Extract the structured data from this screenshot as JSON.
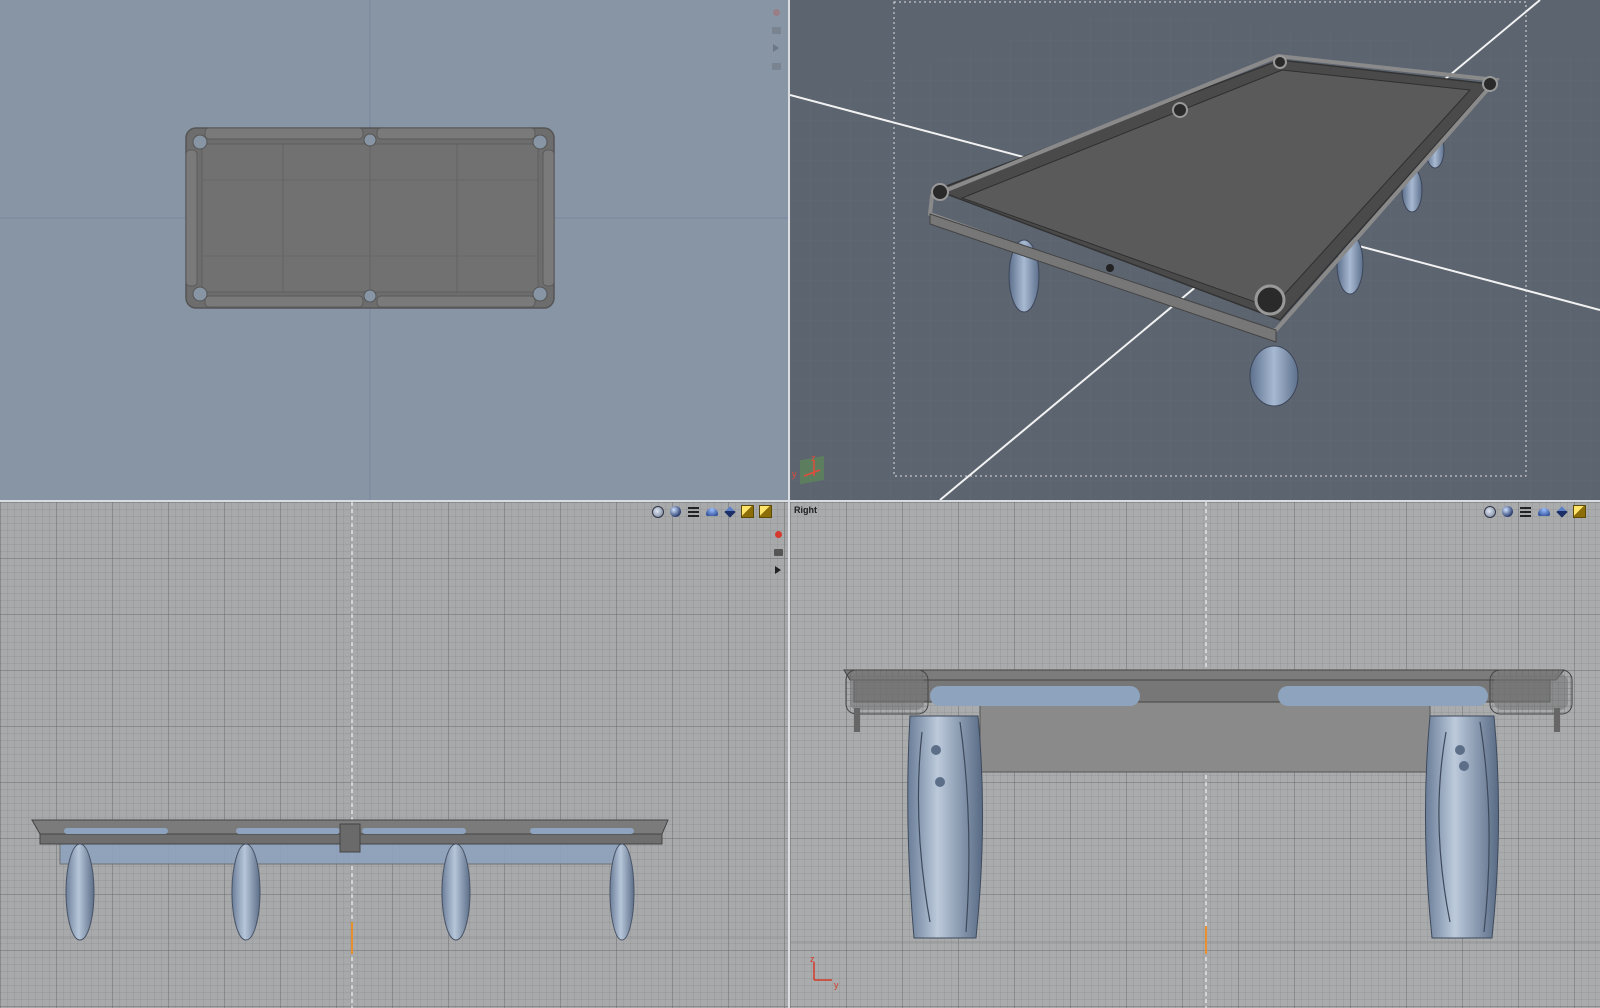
{
  "viewports": {
    "top": {
      "label": ""
    },
    "perspective": {
      "label": "",
      "axis_y": "y",
      "axis_z": "z"
    },
    "front": {
      "label": ""
    },
    "right": {
      "label": "Right",
      "axis_z": "z",
      "axis_y": "y"
    }
  },
  "toolbar_icons": [
    "wireframe-globe-icon",
    "shaded-sphere-icon",
    "display-options-icon",
    "lighting-icon",
    "solid-cube-icon",
    "textured-cube-icon"
  ],
  "side_tool_icons": [
    "record-icon",
    "camera-icon",
    "play-arrow-icon"
  ],
  "colors": {
    "top_bg": "#8795a5",
    "perspective_bg": "#5c6470",
    "ortho_bg": "#a9abad",
    "model_gray": "#6e6e6e",
    "legs_blue": "#8ea3bd",
    "axis_marker": "#e7902d"
  }
}
